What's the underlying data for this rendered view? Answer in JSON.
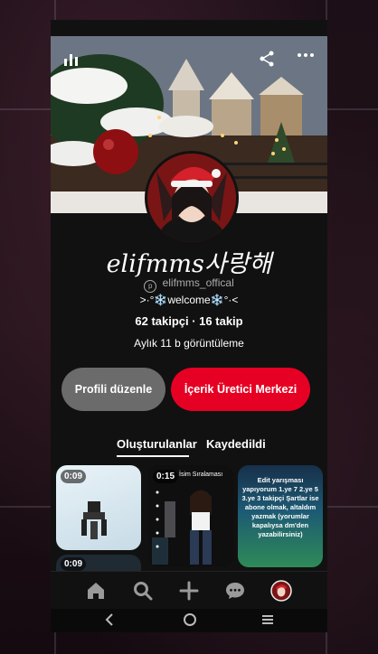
{
  "profile": {
    "display_name": "elifmms사랑해",
    "handle": "elifmms_offical",
    "bio": ">·°❄️welcome❄️°·<",
    "followers_following": "62 takipçi · 16 takip",
    "monthly_views": "Aylık 11 b görüntüleme"
  },
  "actions": {
    "edit_profile": "Profili düzenle",
    "creator_hub": "İçerik Üretici Merkezi"
  },
  "tabs": [
    {
      "label": "Oluşturulanlar",
      "active": true
    },
    {
      "label": "Kaydedildi",
      "active": false
    }
  ],
  "pins": [
    {
      "duration": "0:09"
    },
    {
      "duration": "0:15",
      "caption": "İsim  Sıralaması"
    },
    {
      "caption": "Edit yarışması yapıyorum 1.ye 7 2.ye 5 3.ye 3 takipçi Şartlar ise abone olmak, altaldım yazmak (yorumlar kapalıysa dm'den yazabilirsiniz)"
    },
    {
      "duration": "0:09"
    }
  ],
  "icons": {
    "stats": "bar-chart-icon",
    "share": "share-icon",
    "more": "more-icon",
    "pinterest": "pinterest-logo-icon",
    "home": "home-icon",
    "search": "search-icon",
    "create": "plus-icon",
    "messages": "chat-icon",
    "profile": "avatar-icon",
    "back": "back-icon",
    "home_system": "circle-icon",
    "recents": "recents-icon"
  },
  "colors": {
    "accent": "#e60023",
    "background": "#111111",
    "secondary_button": "#6b6b6b"
  }
}
